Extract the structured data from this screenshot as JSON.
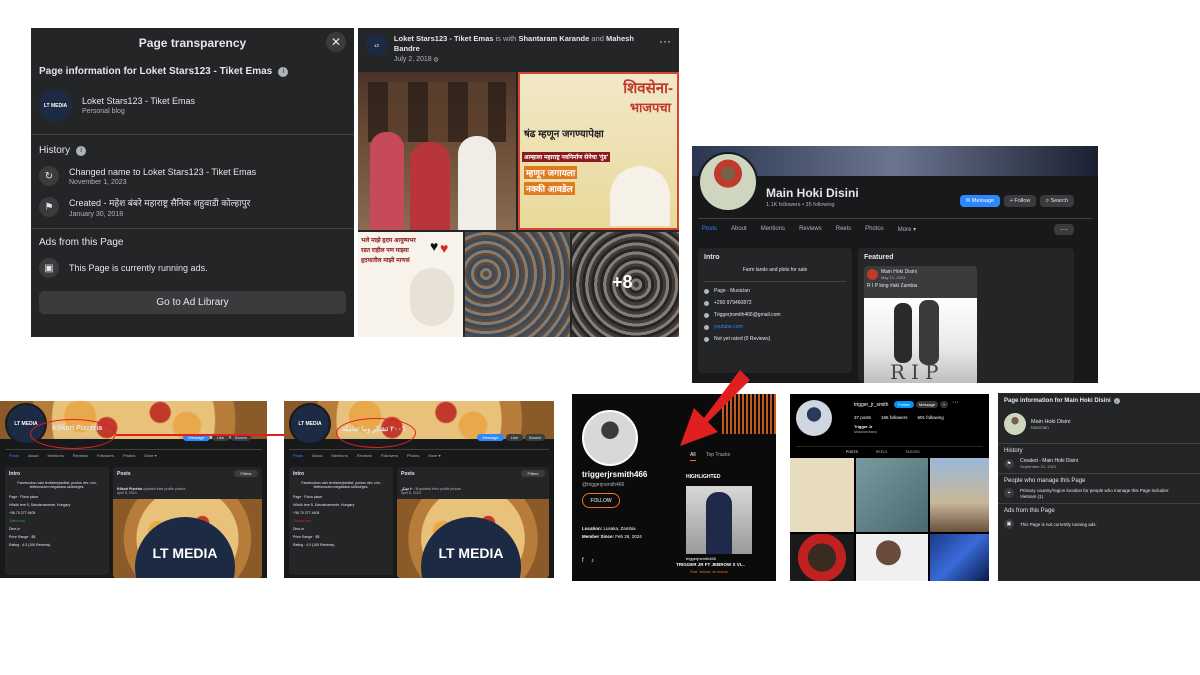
{
  "transparency_panel": {
    "title": "Page transparency",
    "page_info_heading": "Page information for Loket Stars123 - Tiket Emas",
    "page_name": "Loket Stars123 - Tiket Emas",
    "page_category": "Personal blog",
    "avatar_text": "LT MEDIA",
    "history_heading": "History",
    "history": [
      {
        "icon": "name-change-icon",
        "text": "Changed name to Loket Stars123 - Tiket Emas",
        "date": "November 1, 2023"
      },
      {
        "icon": "flag-icon",
        "text": "Created - महेश बंबरे महाराष्ट्र सैनिक शहुवाडी कोल्हापुर",
        "date": "January 30, 2018"
      }
    ],
    "ads_heading": "Ads from this Page",
    "ads_text": "This Page is currently running ads.",
    "ad_library_button": "Go to Ad Library"
  },
  "post": {
    "author": "Loket Stars123 - Tiket Emas",
    "with_text": "is with",
    "tagged_1": "Shantaram Karande",
    "and_text": "and",
    "tagged_2": "Mahesh Bandre",
    "date": "July 2, 2018",
    "poster_line1": "शिवसेना-",
    "poster_line2": "भाजपचा",
    "poster_line3": "षंढ म्हणून जगण्यापेक्षा",
    "poster_line4": "आम्हाला महाराष्ट्र नवनिर्माण सेनेचा 'गुंड'",
    "poster_line5": "म्हणून जगायला",
    "poster_line6": "नक्की आवडेल",
    "teddy_text": "भले माझे हृदय आयुष्यभर रडत राहील पण माझ्या हृदयातील माझी माणसं",
    "more_photos": "+8"
  },
  "musician_page": {
    "name": "Main Hoki Disini",
    "stats": "1.1K followers • 35 following",
    "message_button": "Message",
    "follow_button": "Follow",
    "search_button": "Search",
    "tabs": [
      "Posts",
      "About",
      "Mentions",
      "Reviews",
      "Reels",
      "Photos",
      "More ▾"
    ],
    "intro_heading": "Intro",
    "intro_bio": "Farm lands and plots for sale",
    "intro_rows": [
      {
        "icon": "info-icon",
        "text": "Page · Musician"
      },
      {
        "icon": "phone-icon",
        "text": "+260 979460872"
      },
      {
        "icon": "email-icon",
        "text": "Triggerjrsmith466@gmail.com"
      },
      {
        "icon": "link-icon",
        "text": "youtube.com"
      },
      {
        "icon": "star-icon",
        "text": "Not yet rated (0 Reviews)"
      }
    ],
    "featured_heading": "Featured",
    "featured_author": "Main Hoki Disini",
    "featured_date": "May 12, 2023",
    "featured_caption": "R I P king #aki Zambia",
    "rip_text": "RIP"
  },
  "pizza_page_1": {
    "name": "Kőkori Pizzéria",
    "stats": "5.6K likes • 6.7K followers",
    "tabs": [
      "Posts",
      "About",
      "Mentions",
      "Reviews",
      "Followers",
      "Photos",
      "More ▾"
    ],
    "message_button": "Message",
    "like_button": "Like",
    "search_button": "Search",
    "intro_heading": "Intro",
    "intro_bio": "Facebookon való tevékenykedést, pontos név, cím, telefonszám megadása szükséges.",
    "intro_rows": [
      "Page · Pizza place",
      "Hősök tere 5, Sásvárosmente, Hungary",
      "+36 70 277 4405",
      "Open now",
      "Dine-in",
      "Price Range · $$",
      "Rating · 4.3 (106 Reviews)"
    ],
    "posts_heading": "Posts",
    "filters_button": "Filters",
    "post_author": "Kőkori Pizzéria",
    "post_text": "updated their profile picture.",
    "post_date": "April 8, 2024",
    "logo_text": "LT MEDIA",
    "avatar_text": "LT MEDIA"
  },
  "pizza_page_2": {
    "name": "٢٠٠٦ تشكر وما تعاملة",
    "stats": "5.6K likes • 6.7K followers",
    "tabs": [
      "Posts",
      "About",
      "Mentions",
      "Reviews",
      "Followers",
      "Photos",
      "More ▾"
    ],
    "message_button": "Message",
    "like_button": "Like",
    "search_button": "Search",
    "intro_heading": "Intro",
    "intro_bio": "Facebookon való tevékenykedést, pontos név, cím, telefonszám megadása szükséges.",
    "intro_rows": [
      "Page · Pizza place",
      "Hősök tere 5, Sásvárosmente, Hungary",
      "+36 70 277 4405",
      "Closed now",
      "Dine-in",
      "Price Range · $$",
      "Rating · 4.3 (105 Reviews)"
    ],
    "posts_heading": "Posts",
    "filters_button": "Filters",
    "post_author": "٢٠٠٦ تشكر",
    "post_text": "updated their profile picture.",
    "post_date": "April 8, 2024",
    "logo_text": "LT MEDIA",
    "avatar_text": "LT MEDIA"
  },
  "music_profile": {
    "username": "triggerjrsmith466",
    "handle": "@triggerjrsmith466",
    "follow_button": "FOLLOW",
    "tabs": [
      "All",
      "Top Tracks"
    ],
    "highlighted_heading": "HIGHLIGHTED",
    "track_artist": "triggerjrsmith466",
    "track_title": "TRIGGER JR FT JEBROW X VI...",
    "track_feat": "Feat. Jebrow, vic bronze",
    "location_label": "Location:",
    "location_value": "Lusaka, Zambia",
    "member_label": "Member Since:",
    "member_value": "Feb 26, 2024"
  },
  "instagram_profile": {
    "username": "trigger_jr_smith",
    "follow_button": "Follow",
    "message_button": "Message",
    "posts_count": "37 posts",
    "followers_count": "166 followers",
    "following_count": "601 following",
    "display_name": "Trigger Jr",
    "category": "Musician/band",
    "tabs": [
      "POSTS",
      "REELS",
      "TAGGED"
    ]
  },
  "page_info_panel": {
    "heading": "Page information for Main Hoki Disini",
    "page_name": "Main Hoki Disini",
    "page_category": "Musician",
    "history_heading": "History",
    "history_text": "Created - Main Hoki Disini",
    "history_date": "September 21, 2021",
    "managers_heading": "People who manage this Page",
    "managers_text": "Primary country/region location for people who manage this Page includes:",
    "managers_country": "Vietnam (1)",
    "ads_heading": "Ads from this Page",
    "ads_text": "This Page is not currently running ads."
  },
  "colors": {
    "fb_dark": "#242526",
    "fb_blue": "#2d88ff",
    "annotation_red": "#e02020",
    "soundcloud_orange": "#f26f23"
  }
}
